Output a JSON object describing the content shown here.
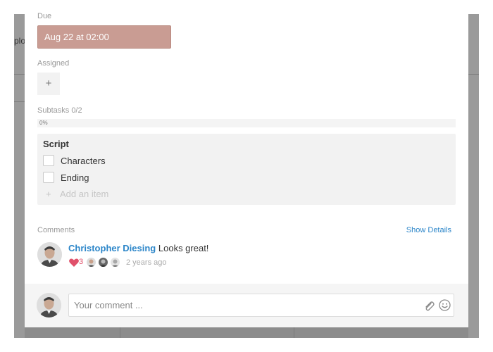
{
  "background": {
    "side_text": "plo"
  },
  "task": {
    "due_label": "Due",
    "due_value": "Aug 22 at 02:00",
    "assigned_label": "Assigned",
    "assign_button": "+",
    "subtasks_label": "Subtasks",
    "subtasks_count": "0/2",
    "progress_text": "0%",
    "progress_fraction": 0
  },
  "checklist": {
    "title": "Script",
    "items": [
      {
        "label": "Characters",
        "checked": false
      },
      {
        "label": "Ending",
        "checked": false
      }
    ],
    "add_item_plus": "+",
    "add_item_placeholder": "Add an item"
  },
  "comments": {
    "label": "Comments",
    "show_details": "Show Details",
    "list": [
      {
        "author": "Christopher Diesing",
        "text": "Looks great!",
        "reaction_count": "3",
        "time": "2 years ago"
      }
    ]
  },
  "composer": {
    "placeholder": "Your comment ..."
  },
  "colors": {
    "due_bg": "#c99c93",
    "link": "#2c86c9",
    "heart": "#e0506a"
  }
}
